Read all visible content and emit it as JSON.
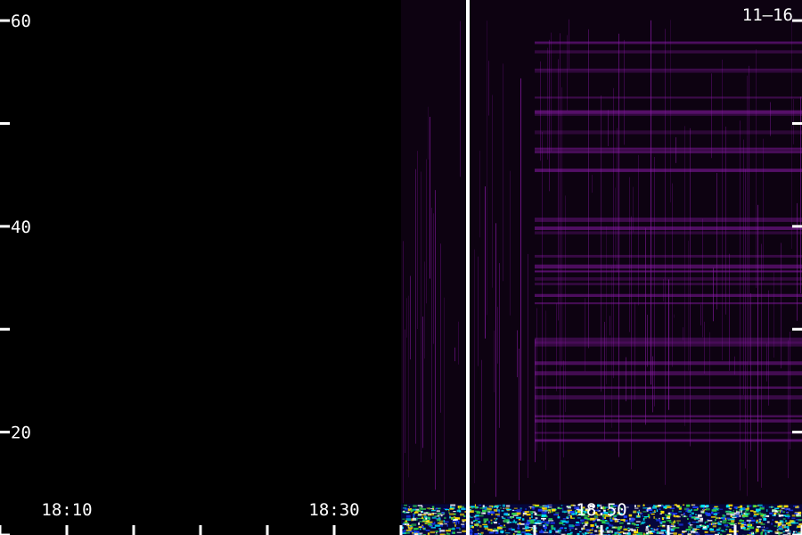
{
  "chart_data": {
    "type": "heatmap",
    "title": "",
    "date_label": "11–16",
    "xlabel": "",
    "ylabel": "",
    "y_range": [
      10,
      62
    ],
    "y_ticks_major": [
      {
        "value": 20,
        "label": "20"
      },
      {
        "value": 40,
        "label": "40"
      },
      {
        "value": 60,
        "label": "60"
      }
    ],
    "y_ticks_minor": [
      10,
      30,
      50
    ],
    "x_range_minutes": [
      "18:05",
      "18:65"
    ],
    "x_ticks_labeled": [
      {
        "time": "18:10",
        "label": "18:10"
      },
      {
        "time": "18:30",
        "label": "18:30"
      },
      {
        "time": "18:50",
        "label": "18:50"
      }
    ],
    "x_ticks_minor": [
      "18:05",
      "18:15",
      "18:20",
      "18:25",
      "18:35",
      "18:40",
      "18:45",
      "18:55",
      "18:60",
      "18:65"
    ],
    "marker_time": "18:40",
    "data_start_time": "18:35",
    "noise_band_top": 13,
    "colors": {
      "background": "#000000",
      "axis": "#ffffff",
      "marker": "#ffffff",
      "low_intensity": "#4a0a5c",
      "mid_intensity": "#8a1aa8",
      "noise": [
        "#00e5ff",
        "#1a3cff",
        "#ffffff",
        "#ffe000",
        "#2bd14a"
      ]
    }
  }
}
